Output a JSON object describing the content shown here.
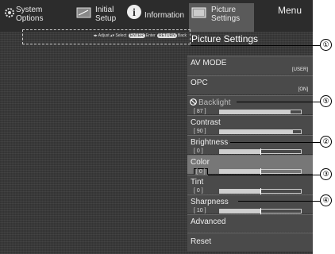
{
  "tabs": [
    {
      "label": "System\nOptions",
      "icon": "gear-icon"
    },
    {
      "label": "Initial\nSetup",
      "icon": "setup-icon"
    },
    {
      "label": "Information",
      "icon": "info-icon"
    },
    {
      "label": "Picture\nSettings",
      "icon": "picture-icon"
    }
  ],
  "menu_label": "Menu",
  "hint": {
    "adjust": "◂▸ Adjust",
    "select": "▴▾ Select",
    "enter_key": "ENTER",
    "enter": "Enter",
    "back_key": "RETURN",
    "back": "Back"
  },
  "section_title": "Picture Settings",
  "items": {
    "av_mode": {
      "label": "AV MODE",
      "value": "[USER]"
    },
    "opc": {
      "label": "OPC",
      "value": "[ON]"
    },
    "backlight": {
      "label": "Backlight",
      "value": "[ 87 ]",
      "level": 0.87
    },
    "contrast": {
      "label": "Contrast",
      "value": "[ 90 ]",
      "level": 0.9
    },
    "brightness": {
      "label": "Brightness",
      "value": "[ 0 ]",
      "level": 0.5
    },
    "color": {
      "label": "Color",
      "value": "[ 0 ]",
      "level": 0.5
    },
    "tint": {
      "label": "Tint",
      "value": "[ 0 ]",
      "level": 0.5
    },
    "sharpness": {
      "label": "Sharpness",
      "value": "[ 10 ]",
      "level": 0.5
    },
    "advanced": {
      "label": "Advanced"
    },
    "reset": {
      "label": "Reset"
    }
  },
  "callouts": [
    "①",
    "②",
    "③",
    "④",
    "⑤"
  ]
}
